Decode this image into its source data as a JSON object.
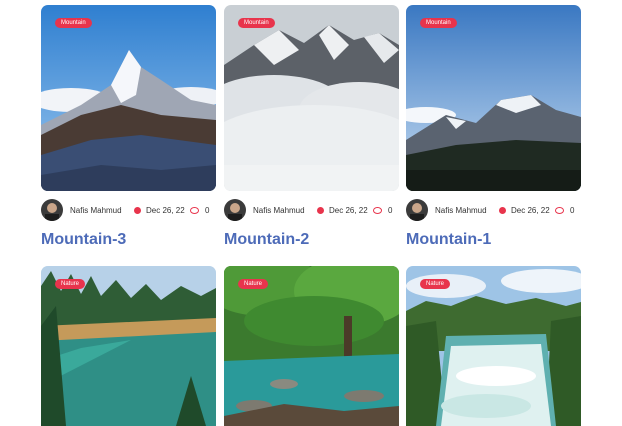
{
  "posts_row1": [
    {
      "category": "Mountain",
      "author": "Nafis Mahmud",
      "date": "Dec 26, 22",
      "comments": "0",
      "title": "Mountain-3"
    },
    {
      "category": "Mountain",
      "author": "Nafis Mahmud",
      "date": "Dec 26, 22",
      "comments": "0",
      "title": "Mountain-2"
    },
    {
      "category": "Mountain",
      "author": "Nafis Mahmud",
      "date": "Dec 26, 22",
      "comments": "0",
      "title": "Mountain-1"
    }
  ],
  "posts_row2": [
    {
      "category": "Nature"
    },
    {
      "category": "Nature"
    },
    {
      "category": "Nature"
    }
  ],
  "colors": {
    "badge": "#e8344c",
    "title": "#4d6bb8"
  },
  "icons": [
    "calendar-icon",
    "comment-icon",
    "avatar"
  ]
}
